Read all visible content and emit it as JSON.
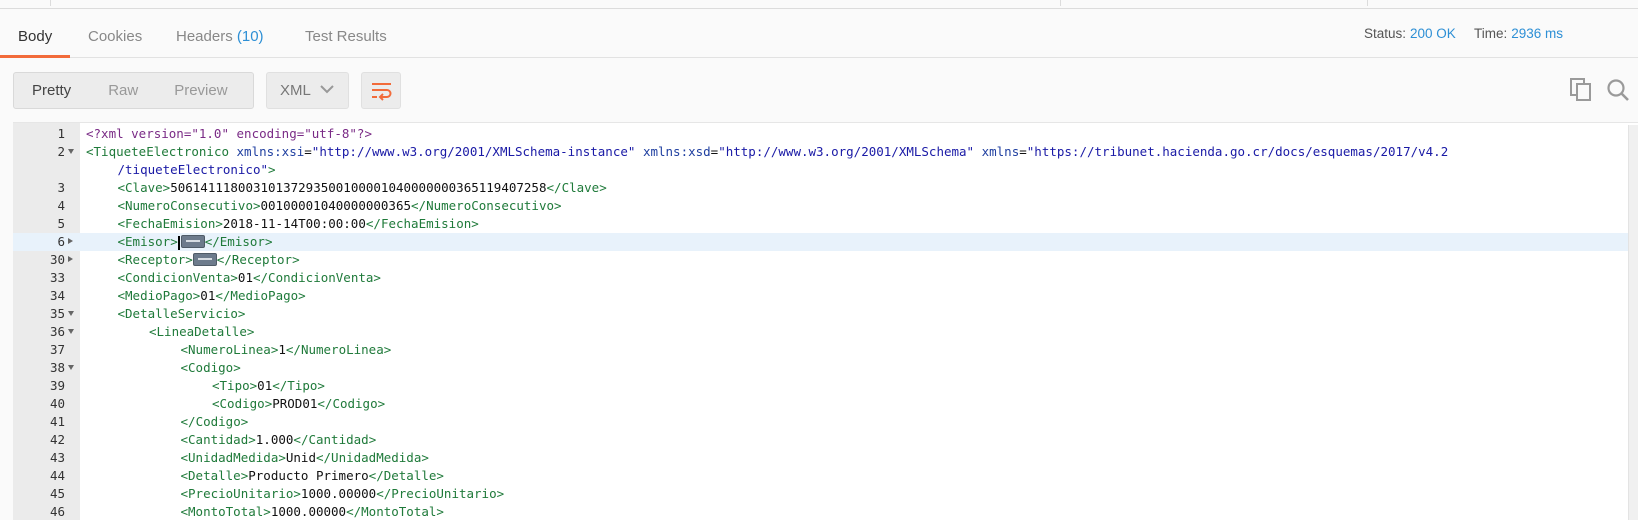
{
  "tabs": [
    {
      "label": "Body",
      "active": true
    },
    {
      "label": "Cookies",
      "active": false
    },
    {
      "label": "Headers",
      "count": "(10)",
      "active": false
    },
    {
      "label": "Test Results",
      "active": false
    }
  ],
  "status": {
    "label": "Status:",
    "value": "200 OK"
  },
  "time": {
    "label": "Time:",
    "value": "2936 ms"
  },
  "view_modes": [
    "Pretty",
    "Raw",
    "Preview"
  ],
  "active_view_mode": "Pretty",
  "format": {
    "selected": "XML"
  },
  "icons": {
    "wrap": "wrap-lines-icon",
    "copy": "copy-icon",
    "search": "search-icon"
  },
  "colors": {
    "accent": "#f26b3a",
    "link": "#2d8fd5"
  },
  "editor": {
    "highlighted_line": "6",
    "lines": [
      {
        "n": "1",
        "fold": "",
        "indent": 0,
        "prolog": "<?xml version=\"1.0\" encoding=\"utf-8\"?>"
      },
      {
        "n": "2",
        "fold": "down",
        "indent": 0,
        "open": "TiqueteElectronico",
        "attrs": [
          {
            "name": "xmlns:xsi",
            "value": "\"http://www.w3.org/2001/XMLSchema-instance\""
          },
          {
            "name": "xmlns:xsd",
            "value": "\"http://www.w3.org/2001/XMLSchema\""
          },
          {
            "name": "xmlns",
            "value": "\"https://tribunet.hacienda.go.cr/docs/esquemas/2017/v4.2"
          }
        ],
        "end": ""
      },
      {
        "n": "",
        "fold": "",
        "indent": 1,
        "cont": "/tiqueteElectronico\"",
        "end": ">"
      },
      {
        "n": "3",
        "fold": "",
        "indent": 1,
        "tag": "Clave",
        "text": "50614111800310137293500100001040000000365119407258"
      },
      {
        "n": "4",
        "fold": "",
        "indent": 1,
        "tag": "NumeroConsecutivo",
        "text": "00100001040000000365"
      },
      {
        "n": "5",
        "fold": "",
        "indent": 1,
        "tag": "FechaEmision",
        "text": "2018-11-14T00:00:00"
      },
      {
        "n": "6",
        "fold": "right",
        "indent": 1,
        "tag": "Emisor",
        "collapsed": true,
        "caret": true
      },
      {
        "n": "30",
        "fold": "right",
        "indent": 1,
        "tag": "Receptor",
        "collapsed": true
      },
      {
        "n": "33",
        "fold": "",
        "indent": 1,
        "tag": "CondicionVenta",
        "text": "01"
      },
      {
        "n": "34",
        "fold": "",
        "indent": 1,
        "tag": "MedioPago",
        "text": "01"
      },
      {
        "n": "35",
        "fold": "down",
        "indent": 1,
        "open": "DetalleServicio"
      },
      {
        "n": "36",
        "fold": "down",
        "indent": 2,
        "open": "LineaDetalle"
      },
      {
        "n": "37",
        "fold": "",
        "indent": 3,
        "tag": "NumeroLinea",
        "text": "1"
      },
      {
        "n": "38",
        "fold": "down",
        "indent": 3,
        "open": "Codigo"
      },
      {
        "n": "39",
        "fold": "",
        "indent": 4,
        "tag": "Tipo",
        "text": "01"
      },
      {
        "n": "40",
        "fold": "",
        "indent": 4,
        "tag": "Codigo",
        "text": "PROD01"
      },
      {
        "n": "41",
        "fold": "",
        "indent": 3,
        "close": "Codigo"
      },
      {
        "n": "42",
        "fold": "",
        "indent": 3,
        "tag": "Cantidad",
        "text": "1.000"
      },
      {
        "n": "43",
        "fold": "",
        "indent": 3,
        "tag": "UnidadMedida",
        "text": "Unid"
      },
      {
        "n": "44",
        "fold": "",
        "indent": 3,
        "tag": "Detalle",
        "text": "Producto Primero"
      },
      {
        "n": "45",
        "fold": "",
        "indent": 3,
        "tag": "PrecioUnitario",
        "text": "1000.00000"
      },
      {
        "n": "46",
        "fold": "",
        "indent": 3,
        "tag": "MontoTotal",
        "text": "1000.00000"
      }
    ]
  }
}
